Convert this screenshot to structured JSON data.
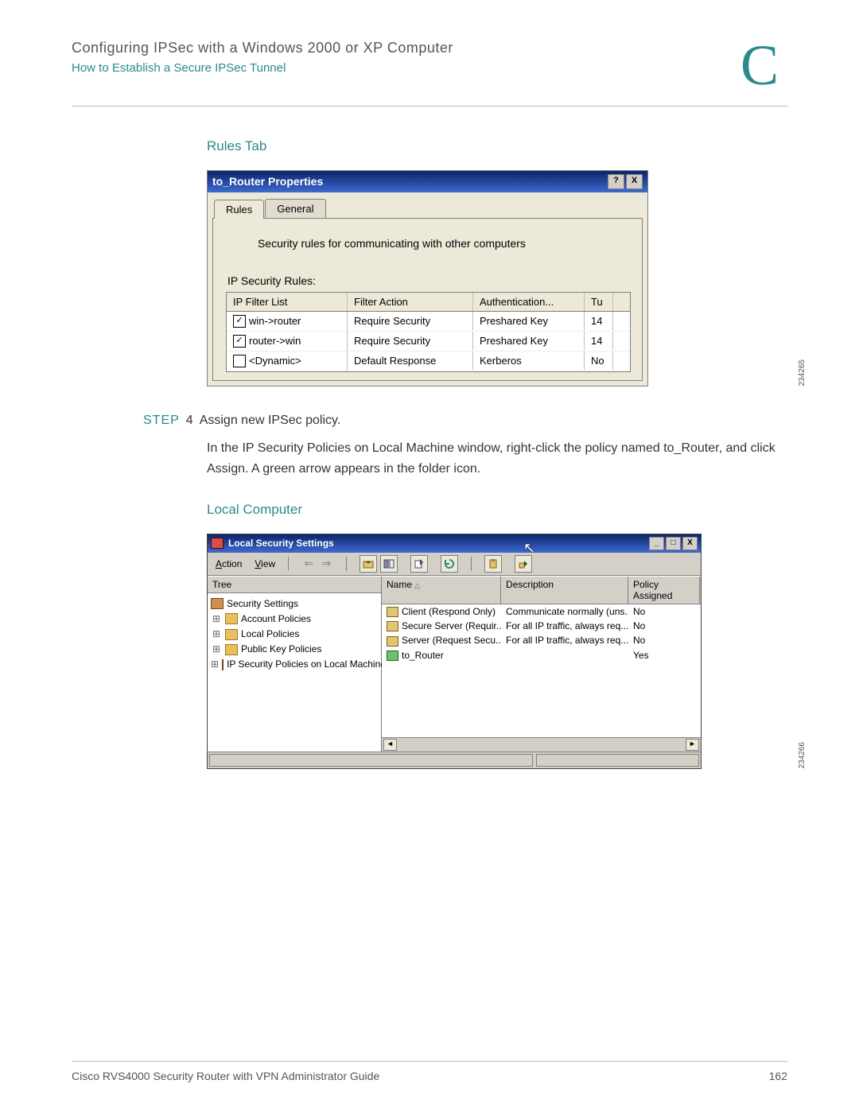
{
  "header": {
    "chapter_title": "Configuring IPSec with a Windows 2000 or XP Computer",
    "subtitle": "How to Establish a Secure IPSec Tunnel",
    "appendix_letter": "C"
  },
  "section1_heading": "Rules Tab",
  "dialog1": {
    "title": "to_Router Properties",
    "help_btn": "?",
    "close_btn": "X",
    "tabs": {
      "active": "Rules",
      "inactive": "General"
    },
    "description": "Security rules for communicating with other computers",
    "rules_label": "IP Security Rules:",
    "columns": {
      "c1": "IP Filter List",
      "c2": "Filter Action",
      "c3": "Authentication...",
      "c4": "Tu"
    },
    "rows": [
      {
        "checked": true,
        "c1": "win->router",
        "c2": "Require Security",
        "c3": "Preshared Key",
        "c4": "14"
      },
      {
        "checked": true,
        "c1": "router->win",
        "c2": "Require Security",
        "c3": "Preshared Key",
        "c4": "14"
      },
      {
        "checked": false,
        "c1": "<Dynamic>",
        "c2": "Default Response",
        "c3": "Kerberos",
        "c4": "No"
      }
    ],
    "fig_num": "234265"
  },
  "step": {
    "label": "STEP",
    "num": "4",
    "title": "Assign new IPSec policy.",
    "body": "In the IP Security Policies on Local Machine window, right-click the policy named to_Router, and click Assign. A green arrow appears in the folder icon."
  },
  "section2_heading": "Local Computer",
  "dialog2": {
    "title": "Local Security Settings",
    "min_btn": "_",
    "max_btn": "□",
    "close_btn": "X",
    "menu": {
      "action": "Action",
      "view": "View"
    },
    "tree_head": "Tree",
    "tree": [
      {
        "indent": 0,
        "expand": "",
        "icon": "book",
        "label": "Security Settings"
      },
      {
        "indent": 1,
        "expand": "+",
        "icon": "folder",
        "label": "Account Policies"
      },
      {
        "indent": 1,
        "expand": "+",
        "icon": "folder",
        "label": "Local Policies"
      },
      {
        "indent": 1,
        "expand": "+",
        "icon": "folder",
        "label": "Public Key Policies"
      },
      {
        "indent": 1,
        "expand": "+",
        "icon": "book",
        "label": "IP Security Policies on Local Machine"
      }
    ],
    "list_columns": {
      "lc1": "Name",
      "lc2": "Description",
      "lc3": "Policy Assigned"
    },
    "list_rows": [
      {
        "assigned_icon": false,
        "name": "Client (Respond Only)",
        "desc": "Communicate normally (uns...",
        "assigned": "No"
      },
      {
        "assigned_icon": false,
        "name": "Secure Server (Requir...",
        "desc": "For all IP traffic, always req...",
        "assigned": "No"
      },
      {
        "assigned_icon": false,
        "name": "Server (Request Secu...",
        "desc": "For all IP traffic, always req...",
        "assigned": "No"
      },
      {
        "assigned_icon": true,
        "name": "to_Router",
        "desc": "",
        "assigned": "Yes"
      }
    ],
    "fig_num": "234266"
  },
  "footer": {
    "left": "Cisco RVS4000 Security Router with VPN Administrator Guide",
    "right": "162"
  }
}
